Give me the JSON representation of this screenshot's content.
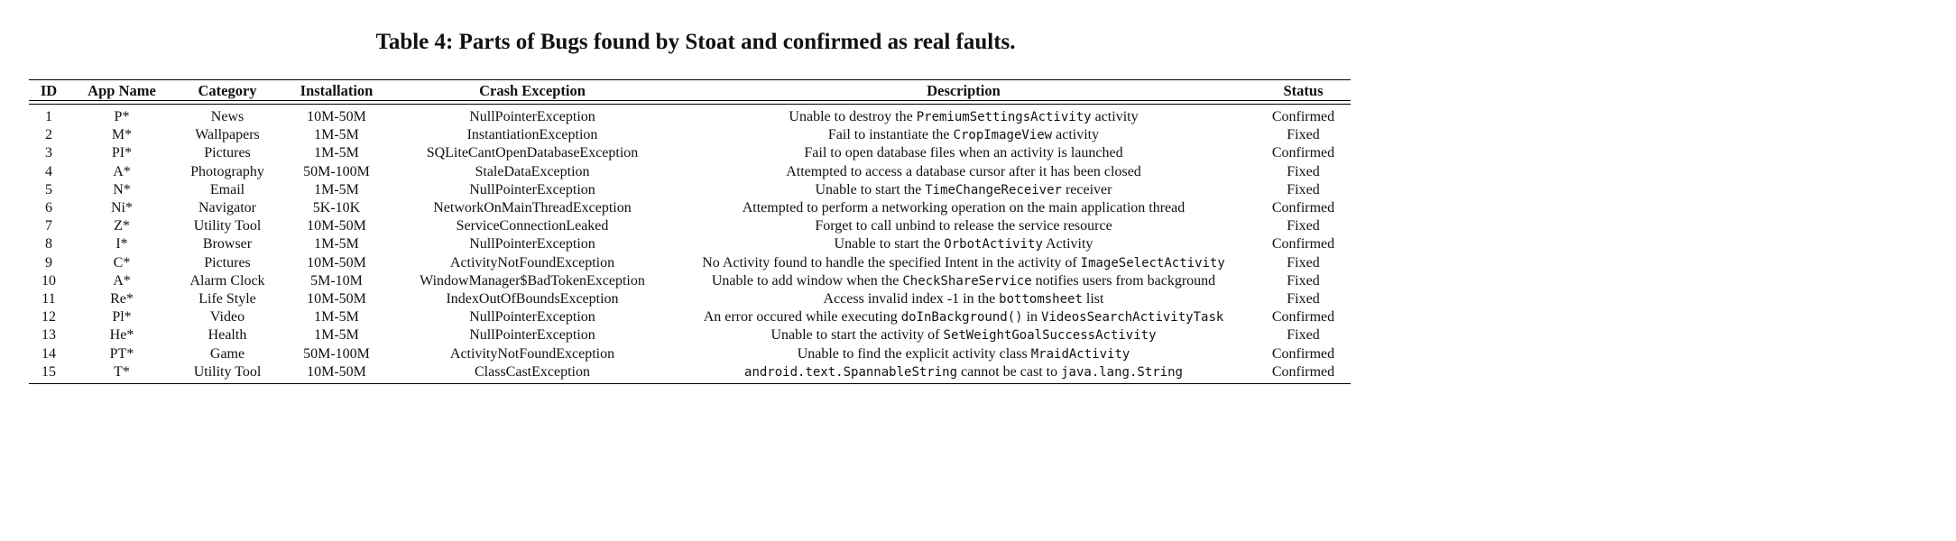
{
  "caption": "Table 4: Parts of Bugs found by Stoat and confirmed as real faults.",
  "columns": [
    "ID",
    "App Name",
    "Category",
    "Installation",
    "Crash Exception",
    "Description",
    "Status"
  ],
  "rows": [
    {
      "id": "1",
      "app": "P*",
      "category": "News",
      "installation": "10M-50M",
      "exception": "NullPointerException",
      "description": [
        {
          "t": "Unable to destroy the "
        },
        {
          "t": "PremiumSettingsActivity",
          "code": true
        },
        {
          "t": " activity"
        }
      ],
      "status": "Confirmed"
    },
    {
      "id": "2",
      "app": "M*",
      "category": "Wallpapers",
      "installation": "1M-5M",
      "exception": "InstantiationException",
      "description": [
        {
          "t": "Fail to instantiate the "
        },
        {
          "t": "CropImageView",
          "code": true
        },
        {
          "t": " activity"
        }
      ],
      "status": "Fixed"
    },
    {
      "id": "3",
      "app": "PI*",
      "category": "Pictures",
      "installation": "1M-5M",
      "exception": "SQLiteCantOpenDatabaseException",
      "description": [
        {
          "t": "Fail to open database files when an activity is launched"
        }
      ],
      "status": "Confirmed"
    },
    {
      "id": "4",
      "app": "A*",
      "category": "Photography",
      "installation": "50M-100M",
      "exception": "StaleDataException",
      "description": [
        {
          "t": "Attempted to access a database cursor after it has been closed"
        }
      ],
      "status": "Fixed"
    },
    {
      "id": "5",
      "app": "N*",
      "category": "Email",
      "installation": "1M-5M",
      "exception": "NullPointerException",
      "description": [
        {
          "t": "Unable to start the "
        },
        {
          "t": "TimeChangeReceiver",
          "code": true
        },
        {
          "t": " receiver"
        }
      ],
      "status": "Fixed"
    },
    {
      "id": "6",
      "app": "Ni*",
      "category": "Navigator",
      "installation": "5K-10K",
      "exception": "NetworkOnMainThreadException",
      "description": [
        {
          "t": "Attempted to perform a networking operation on the main application thread"
        }
      ],
      "status": "Confirmed"
    },
    {
      "id": "7",
      "app": "Z*",
      "category": "Utility Tool",
      "installation": "10M-50M",
      "exception": "ServiceConnectionLeaked",
      "description": [
        {
          "t": "Forget to call unbind to release the service resource"
        }
      ],
      "status": "Fixed"
    },
    {
      "id": "8",
      "app": "I*",
      "category": "Browser",
      "installation": "1M-5M",
      "exception": "NullPointerException",
      "description": [
        {
          "t": "Unable to start the "
        },
        {
          "t": "OrbotActivity",
          "code": true
        },
        {
          "t": " Activity"
        }
      ],
      "status": "Confirmed"
    },
    {
      "id": "9",
      "app": "C*",
      "category": "Pictures",
      "installation": "10M-50M",
      "exception": "ActivityNotFoundException",
      "description": [
        {
          "t": "No Activity found to handle the specified Intent in the activity of "
        },
        {
          "t": "ImageSelectActivity",
          "code": true
        }
      ],
      "status": "Fixed"
    },
    {
      "id": "10",
      "app": "A*",
      "category": "Alarm Clock",
      "installation": "5M-10M",
      "exception": "WindowManager$BadTokenException",
      "description": [
        {
          "t": "Unable to add window when the "
        },
        {
          "t": "CheckShareService",
          "code": true
        },
        {
          "t": " notifies users from background"
        }
      ],
      "status": "Fixed"
    },
    {
      "id": "11",
      "app": "Re*",
      "category": "Life Style",
      "installation": "10M-50M",
      "exception": "IndexOutOfBoundsException",
      "description": [
        {
          "t": "Access invalid index -1 in the "
        },
        {
          "t": "bottomsheet",
          "code": true
        },
        {
          "t": " list"
        }
      ],
      "status": "Fixed"
    },
    {
      "id": "12",
      "app": "Pl*",
      "category": "Video",
      "installation": "1M-5M",
      "exception": "NullPointerException",
      "description": [
        {
          "t": "An error occured while executing "
        },
        {
          "t": "doInBackground()",
          "code": true
        },
        {
          "t": " in "
        },
        {
          "t": "VideosSearchActivityTask",
          "code": true
        }
      ],
      "status": "Confirmed"
    },
    {
      "id": "13",
      "app": "He*",
      "category": "Health",
      "installation": "1M-5M",
      "exception": "NullPointerException",
      "description": [
        {
          "t": "Unable to start the activity of "
        },
        {
          "t": "SetWeightGoalSuccessActivity",
          "code": true
        }
      ],
      "status": "Fixed"
    },
    {
      "id": "14",
      "app": "PT*",
      "category": "Game",
      "installation": "50M-100M",
      "exception": "ActivityNotFoundException",
      "description": [
        {
          "t": "Unable to find the explicit activity class "
        },
        {
          "t": "MraidActivity",
          "code": true
        }
      ],
      "status": "Confirmed"
    },
    {
      "id": "15",
      "app": "T*",
      "category": "Utility Tool",
      "installation": "10M-50M",
      "exception": "ClassCastException",
      "description": [
        {
          "t": "android.text.SpannableString",
          "code": true
        },
        {
          "t": " cannot be cast to "
        },
        {
          "t": "java.lang.String",
          "code": true
        }
      ],
      "status": "Confirmed"
    }
  ]
}
